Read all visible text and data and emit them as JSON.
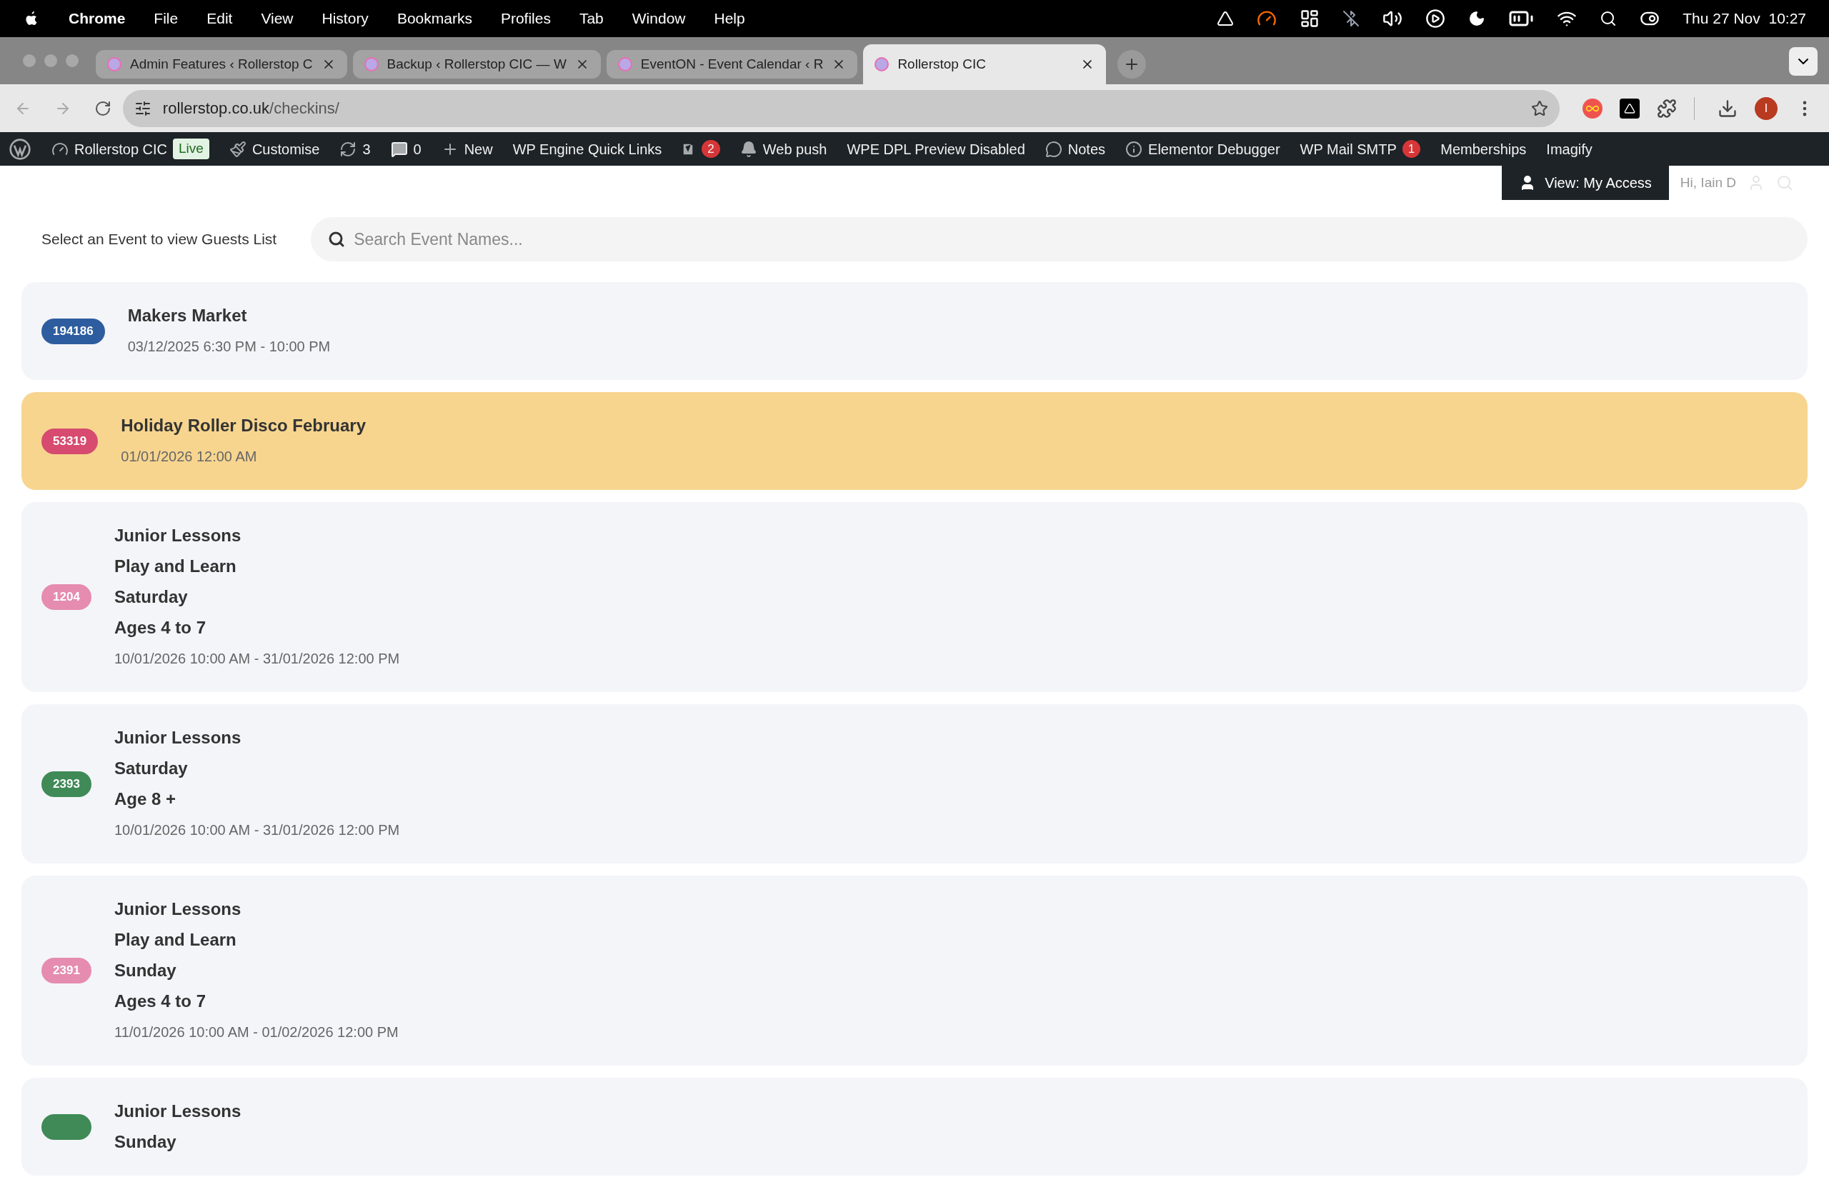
{
  "menu_bar": {
    "app": "Chrome",
    "items": [
      "File",
      "Edit",
      "View",
      "History",
      "Bookmarks",
      "Profiles",
      "Tab",
      "Window",
      "Help"
    ],
    "clock": "Thu 27 Nov  10:27"
  },
  "browser": {
    "tabs": [
      {
        "title": "Admin Features ‹ Rollerstop C",
        "selected": false
      },
      {
        "title": "Backup ‹ Rollerstop CIC — W",
        "selected": false
      },
      {
        "title": "EventON - Event Calendar ‹ R",
        "selected": false
      },
      {
        "title": "Rollerstop CIC",
        "selected": true
      }
    ],
    "url_host": "rollerstop.co.uk",
    "url_path": "/checkins/",
    "profile_initial": "I"
  },
  "admin_bar": {
    "site": "Rollerstop CIC",
    "live": "Live",
    "customise": "Customise",
    "updates": "3",
    "comments": "0",
    "new": "New",
    "quick_links": "WP Engine Quick Links",
    "yoast_count": "2",
    "web_push": "Web push",
    "preview": "WPE DPL Preview Disabled",
    "notes": "Notes",
    "debugger": "Elementor Debugger",
    "smtp": "WP Mail SMTP",
    "smtp_count": "1",
    "memberships": "Memberships",
    "imagify": "Imagify",
    "view_access": "View: My Access",
    "greeting": "Hi, Iain D"
  },
  "page": {
    "select_label": "Select an Event to view Guests List",
    "search": {
      "placeholder": "Search Event Names..."
    },
    "events": [
      {
        "id": "194186",
        "color": "#2d5d9f",
        "selected": false,
        "lines": [
          "Makers Market"
        ],
        "date": "03/12/2025 6:30 PM - 10:00 PM"
      },
      {
        "id": "53319",
        "color": "#d64b6f",
        "selected": true,
        "lines": [
          "Holiday Roller Disco February"
        ],
        "date": "01/01/2026 12:00 AM"
      },
      {
        "id": "1204",
        "color": "#e58cb0",
        "selected": false,
        "lines": [
          "Junior Lessons",
          "Play and Learn",
          "Saturday",
          "Ages 4 to 7"
        ],
        "date": "10/01/2026 10:00 AM - 31/01/2026 12:00 PM"
      },
      {
        "id": "2393",
        "color": "#3f8a57",
        "selected": false,
        "lines": [
          "Junior Lessons",
          "Saturday",
          "Age 8 +"
        ],
        "date": "10/01/2026 10:00 AM - 31/01/2026 12:00 PM"
      },
      {
        "id": "2391",
        "color": "#e58cb0",
        "selected": false,
        "lines": [
          "Junior Lessons",
          "Play and Learn",
          "Sunday",
          "Ages 4 to 7"
        ],
        "date": "11/01/2026 10:00 AM - 01/02/2026 12:00 PM"
      },
      {
        "color": "#3f8a57",
        "selected": false,
        "lines": [
          "Junior Lessons",
          "Sunday"
        ]
      }
    ]
  }
}
